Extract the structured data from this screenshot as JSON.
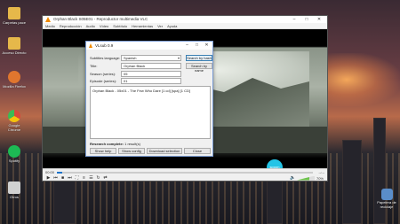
{
  "desktop": {
    "icons": [
      {
        "label": "Carpetas pace",
        "color": "#e6b84a"
      },
      {
        "label": "Acceso Directo",
        "color": "#e6b84a"
      },
      {
        "label": "Mozilla Firefox",
        "color": "#e0762e"
      },
      {
        "label": "Google Chrome",
        "color": "#d64a3a"
      },
      {
        "label": "Spotify",
        "color": "#1db954"
      },
      {
        "label": "Otros",
        "color": "#d1d1d1"
      }
    ],
    "tray_icon": {
      "label": "Papelera de reciclaje"
    }
  },
  "vlc": {
    "title": "Orphan Black S05E01 - Reproductor multimedia VLC",
    "menu": [
      "Medio",
      "Reproducción",
      "Audio",
      "Vídeo",
      "Subtítulo",
      "Herramientas",
      "Ver",
      "Ayuda"
    ],
    "time_elapsed": "00:00",
    "time_total": "--:--",
    "volume_pct": "70%",
    "progress": 0.02,
    "watermark": "spoon"
  },
  "dialog": {
    "title": "VLsub 0.9",
    "subtitles_language_label": "Subtitles language:",
    "subtitles_language_value": "Spanish",
    "search_by_hash_label": "Search by hash",
    "title_label": "Title:",
    "title_value": "Orphan Black",
    "search_by_name_label": "Search by name",
    "season_label": "Season (series):",
    "season_value": "05",
    "episode_label": "Episode (series):",
    "episode_value": "01",
    "results": [
      "Orphan Black - 05x01 - The Few Who Dare [1 cd] [spa] [1 CD]"
    ],
    "status_bold": "Research complete:",
    "status_rest": " 1 result(s)",
    "show_help_label": "Show help",
    "show_config_label": "Show config",
    "download_label": "Download selection",
    "close_label": "Close"
  }
}
